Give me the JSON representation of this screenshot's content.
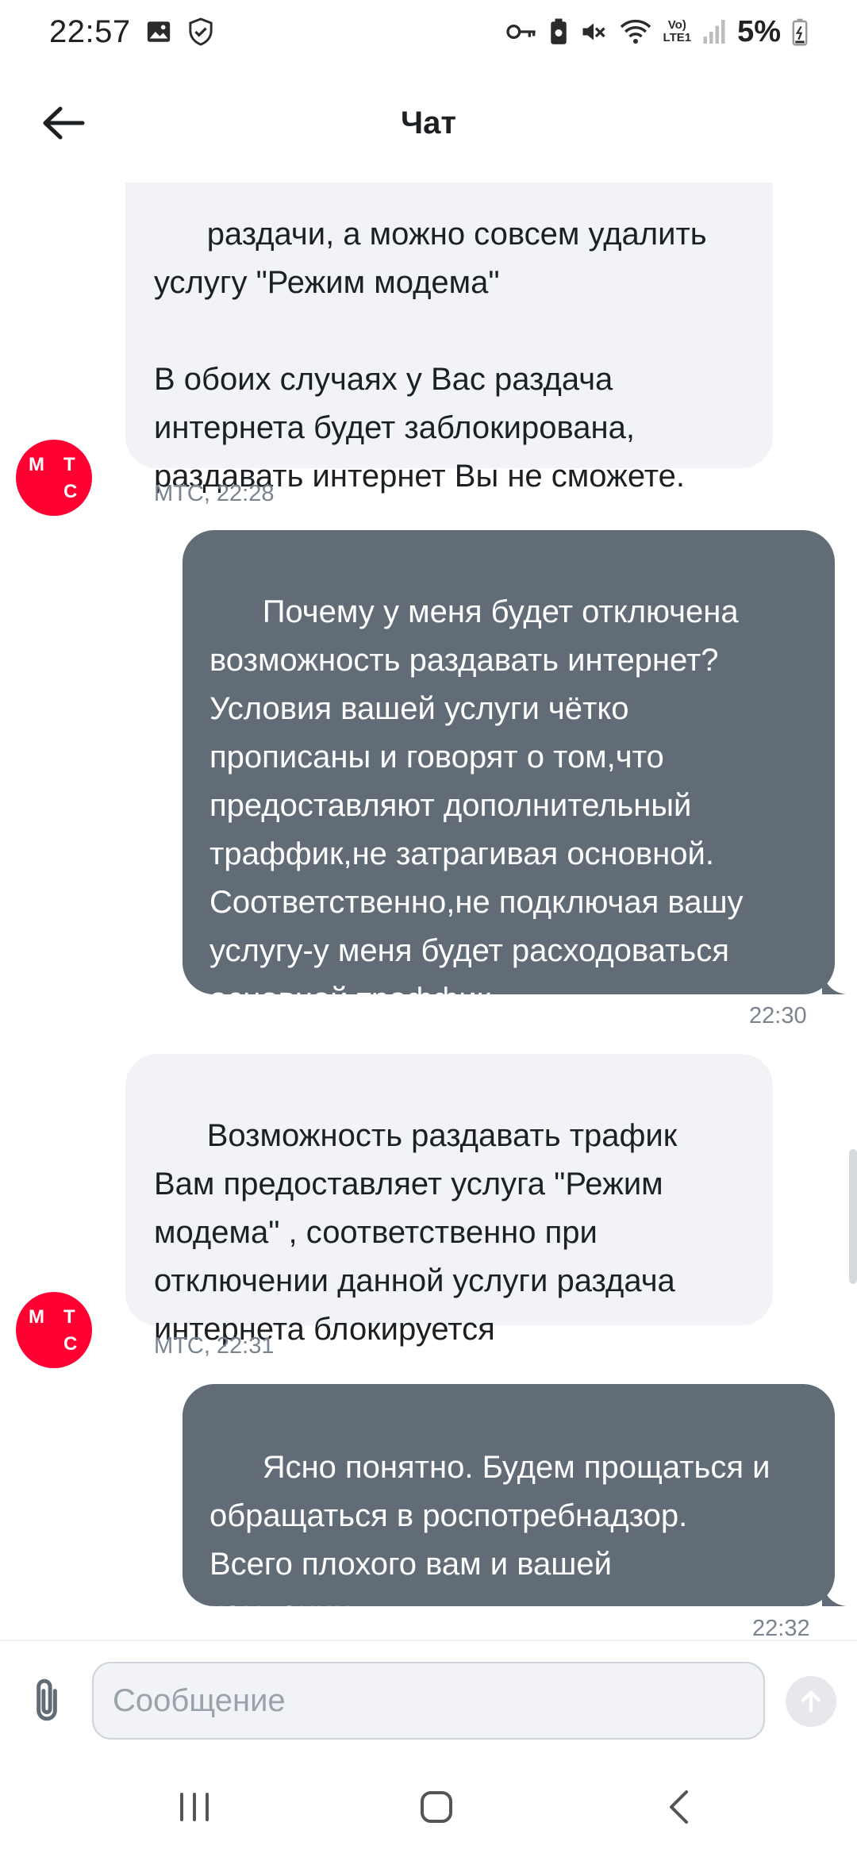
{
  "status_bar": {
    "time": "22:57",
    "battery": "5%",
    "lte_top": "Vo)",
    "lte_bottom": "LTE1"
  },
  "header": {
    "title": "Чат"
  },
  "messages": [
    {
      "direction": "in",
      "text": "раздачи, а можно совсем удалить\nуслугу \"Режим модема\"\n\nВ обоих случаях у Вас раздача\nинтернета будет заблокирована,\nраздавать интернет Вы не сможете.",
      "meta": "МТС, 22:28"
    },
    {
      "direction": "out",
      "text": "Почему у меня будет отключена\nвозможность раздавать интернет?\nУсловия вашей услуги чётко\nпрописаны и говорят о том,что\nпредоставляют дополнительный\nтраффик,не затрагивая основной.\nСоответственно,не подключая вашу\nуслугу-у меня будет расходоваться\nосновной траффик.",
      "meta": "22:30"
    },
    {
      "direction": "in",
      "text": "Возможность раздавать трафик\nВам предоставляет услуга \"Режим\nмодема\" , соответственно при\nотключении данной услуги раздача\nинтернета блокируется",
      "meta": "МТС, 22:31"
    },
    {
      "direction": "out",
      "text": "Ясно понятно. Будем прощаться и\nобращаться в роспотребнадзор.\nВсего плохого вам и вашей\nкомпании",
      "meta": "22:32"
    }
  ],
  "avatar": {
    "l1": "М",
    "l2": "Т",
    "l3": "С"
  },
  "composer": {
    "placeholder": "Сообщение",
    "value": ""
  },
  "colors": {
    "incoming_bubble": "#f2f3f7",
    "outgoing_bubble": "#626c77",
    "brand_red": "#ff0032"
  }
}
